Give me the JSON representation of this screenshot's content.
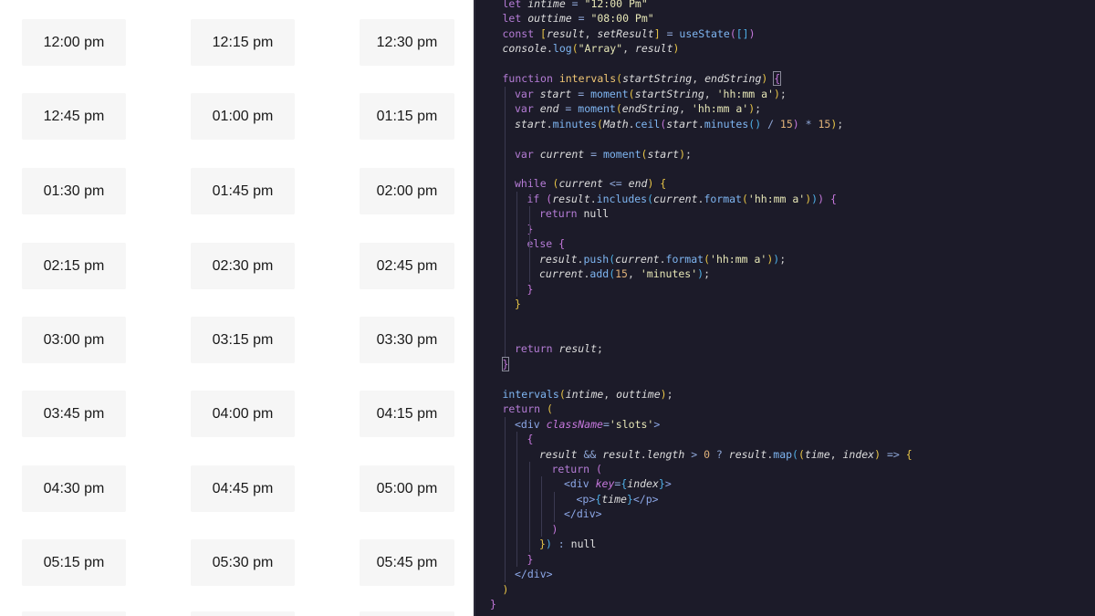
{
  "slots": [
    "12:00 pm",
    "12:15 pm",
    "12:30 pm",
    "12:45 pm",
    "01:00 pm",
    "01:15 pm",
    "01:30 pm",
    "01:45 pm",
    "02:00 pm",
    "02:15 pm",
    "02:30 pm",
    "02:45 pm",
    "03:00 pm",
    "03:15 pm",
    "03:30 pm",
    "03:45 pm",
    "04:00 pm",
    "04:15 pm",
    "04:30 pm",
    "04:45 pm",
    "05:00 pm",
    "05:15 pm",
    "05:30 pm",
    "05:45 pm"
  ],
  "code": {
    "colors": {
      "background": "#1c1b29",
      "keyword": "#b57cd6",
      "function": "#7fb6f2",
      "string": "#e7e7b7"
    },
    "lines": [
      [
        [
          "kw",
          "let "
        ],
        [
          "var",
          "intime"
        ],
        [
          "op",
          " = "
        ],
        [
          "str",
          "\"12:00 Pm\""
        ]
      ],
      [
        [
          "kw",
          "let "
        ],
        [
          "var",
          "outtime"
        ],
        [
          "op",
          " = "
        ],
        [
          "str",
          "\"08:00 Pm\""
        ]
      ],
      [
        [
          "kw",
          "const "
        ],
        [
          "b1",
          "["
        ],
        [
          "var",
          "result"
        ],
        [
          "pn",
          ", "
        ],
        [
          "var",
          "setResult"
        ],
        [
          "b1",
          "]"
        ],
        [
          "op",
          " = "
        ],
        [
          "fn",
          "useState"
        ],
        [
          "b2",
          "("
        ],
        [
          "b3",
          "[]"
        ],
        [
          "b2",
          ")"
        ]
      ],
      [
        [
          "var",
          "console"
        ],
        [
          "pn",
          "."
        ],
        [
          "fn",
          "log"
        ],
        [
          "b1",
          "("
        ],
        [
          "str",
          "\"Array\""
        ],
        [
          "pn",
          ", "
        ],
        [
          "var",
          "result"
        ],
        [
          "b1",
          ")"
        ]
      ],
      [],
      [
        [
          "kw",
          "function "
        ],
        [
          "fnd",
          "intervals"
        ],
        [
          "b1",
          "("
        ],
        [
          "var",
          "startString"
        ],
        [
          "pn",
          ", "
        ],
        [
          "var",
          "endString"
        ],
        [
          "b1",
          ") "
        ],
        [
          "b2",
          "{"
        ]
      ],
      [
        [
          "kw",
          "var "
        ],
        [
          "var",
          "start"
        ],
        [
          "op",
          " = "
        ],
        [
          "fn",
          "moment"
        ],
        [
          "b1",
          "("
        ],
        [
          "var",
          "startString"
        ],
        [
          "pn",
          ", "
        ],
        [
          "str",
          "'hh:mm a'"
        ],
        [
          "b1",
          ")"
        ],
        [
          "pn",
          ";"
        ]
      ],
      [
        [
          "kw",
          "var "
        ],
        [
          "var",
          "end"
        ],
        [
          "op",
          " = "
        ],
        [
          "fn",
          "moment"
        ],
        [
          "b1",
          "("
        ],
        [
          "var",
          "endString"
        ],
        [
          "pn",
          ", "
        ],
        [
          "str",
          "'hh:mm a'"
        ],
        [
          "b1",
          ")"
        ],
        [
          "pn",
          ";"
        ]
      ],
      [
        [
          "var",
          "start"
        ],
        [
          "pn",
          "."
        ],
        [
          "fn",
          "minutes"
        ],
        [
          "b1",
          "("
        ],
        [
          "var",
          "Math"
        ],
        [
          "pn",
          "."
        ],
        [
          "fn",
          "ceil"
        ],
        [
          "b2",
          "("
        ],
        [
          "var",
          "start"
        ],
        [
          "pn",
          "."
        ],
        [
          "fn",
          "minutes"
        ],
        [
          "b3",
          "()"
        ],
        [
          "op",
          " / "
        ],
        [
          "num",
          "15"
        ],
        [
          "b2",
          ")"
        ],
        [
          "op",
          " * "
        ],
        [
          "num",
          "15"
        ],
        [
          "b1",
          ")"
        ],
        [
          "pn",
          ";"
        ]
      ],
      [],
      [
        [
          "kw",
          "var "
        ],
        [
          "var",
          "current"
        ],
        [
          "op",
          " = "
        ],
        [
          "fn",
          "moment"
        ],
        [
          "b1",
          "("
        ],
        [
          "var",
          "start"
        ],
        [
          "b1",
          ")"
        ],
        [
          "pn",
          ";"
        ]
      ],
      [],
      [
        [
          "kw",
          "while "
        ],
        [
          "b1",
          "("
        ],
        [
          "var",
          "current"
        ],
        [
          "op",
          " <= "
        ],
        [
          "var",
          "end"
        ],
        [
          "b1",
          ") "
        ],
        [
          "b1",
          "{"
        ]
      ],
      [
        [
          "kw",
          "if "
        ],
        [
          "b2",
          "("
        ],
        [
          "var",
          "result"
        ],
        [
          "pn",
          "."
        ],
        [
          "fn",
          "includes"
        ],
        [
          "b3",
          "("
        ],
        [
          "var",
          "current"
        ],
        [
          "pn",
          "."
        ],
        [
          "fn",
          "format"
        ],
        [
          "b1",
          "("
        ],
        [
          "str",
          "'hh:mm a'"
        ],
        [
          "b1",
          ")"
        ],
        [
          "b3",
          ")"
        ],
        [
          "b2",
          ") "
        ],
        [
          "b2",
          "{"
        ]
      ],
      [
        [
          "kw",
          "return "
        ],
        [
          "nul",
          "null"
        ]
      ],
      [
        [
          "b2",
          "}"
        ]
      ],
      [
        [
          "kw",
          "else "
        ],
        [
          "b2",
          "{"
        ]
      ],
      [
        [
          "var",
          "result"
        ],
        [
          "pn",
          "."
        ],
        [
          "fn",
          "push"
        ],
        [
          "b3",
          "("
        ],
        [
          "var",
          "current"
        ],
        [
          "pn",
          "."
        ],
        [
          "fn",
          "format"
        ],
        [
          "b1",
          "("
        ],
        [
          "str",
          "'hh:mm a'"
        ],
        [
          "b1",
          ")"
        ],
        [
          "b3",
          ")"
        ],
        [
          "pn",
          ";"
        ]
      ],
      [
        [
          "var",
          "current"
        ],
        [
          "pn",
          "."
        ],
        [
          "fn",
          "add"
        ],
        [
          "b3",
          "("
        ],
        [
          "num",
          "15"
        ],
        [
          "pn",
          ", "
        ],
        [
          "str",
          "'minutes'"
        ],
        [
          "b3",
          ")"
        ],
        [
          "pn",
          ";"
        ]
      ],
      [
        [
          "b2",
          "}"
        ]
      ],
      [
        [
          "b1",
          "}"
        ]
      ],
      [],
      [],
      [
        [
          "kw",
          "return "
        ],
        [
          "var",
          "result"
        ],
        [
          "pn",
          ";"
        ]
      ],
      [
        [
          "b2",
          "}"
        ]
      ],
      [],
      [
        [
          "fn",
          "intervals"
        ],
        [
          "b1",
          "("
        ],
        [
          "var",
          "intime"
        ],
        [
          "pn",
          ", "
        ],
        [
          "var",
          "outtime"
        ],
        [
          "b1",
          ")"
        ],
        [
          "pn",
          ";"
        ]
      ],
      [
        [
          "kw",
          "return "
        ],
        [
          "b1",
          "("
        ]
      ],
      [
        [
          "tag",
          "<div "
        ],
        [
          "attr",
          "className"
        ],
        [
          "op",
          "="
        ],
        [
          "str",
          "'slots'"
        ],
        [
          "tag",
          ">"
        ]
      ],
      [
        [
          "b2",
          "{"
        ]
      ],
      [
        [
          "var",
          "result"
        ],
        [
          "op",
          " && "
        ],
        [
          "var",
          "result"
        ],
        [
          "pn",
          "."
        ],
        [
          "var",
          "length"
        ],
        [
          "op",
          " > "
        ],
        [
          "num",
          "0"
        ],
        [
          "op",
          " ? "
        ],
        [
          "var",
          "result"
        ],
        [
          "pn",
          "."
        ],
        [
          "fn",
          "map"
        ],
        [
          "b3",
          "("
        ],
        [
          "b1",
          "("
        ],
        [
          "var",
          "time"
        ],
        [
          "pn",
          ", "
        ],
        [
          "var",
          "index"
        ],
        [
          "b1",
          ")"
        ],
        [
          "op",
          " => "
        ],
        [
          "b1",
          "{"
        ]
      ],
      [
        [
          "kw",
          "return "
        ],
        [
          "b2",
          "("
        ]
      ],
      [
        [
          "tag",
          "<div "
        ],
        [
          "attr",
          "key"
        ],
        [
          "op",
          "="
        ],
        [
          "b3",
          "{"
        ],
        [
          "var",
          "index"
        ],
        [
          "b3",
          "}"
        ],
        [
          "tag",
          ">"
        ]
      ],
      [
        [
          "tag",
          "<p>"
        ],
        [
          "b3",
          "{"
        ],
        [
          "var",
          "time"
        ],
        [
          "b3",
          "}"
        ],
        [
          "tag",
          "</p>"
        ]
      ],
      [
        [
          "tag",
          "</div>"
        ]
      ],
      [
        [
          "b2",
          ")"
        ]
      ],
      [
        [
          "b1",
          "}"
        ],
        [
          "b3",
          ")"
        ],
        [
          "op",
          " : "
        ],
        [
          "nul",
          "null"
        ]
      ],
      [
        [
          "b2",
          "}"
        ]
      ],
      [
        [
          "tag",
          "</div>"
        ]
      ],
      [
        [
          "b1",
          ")"
        ]
      ],
      [
        [
          "b2",
          "}"
        ]
      ]
    ]
  }
}
